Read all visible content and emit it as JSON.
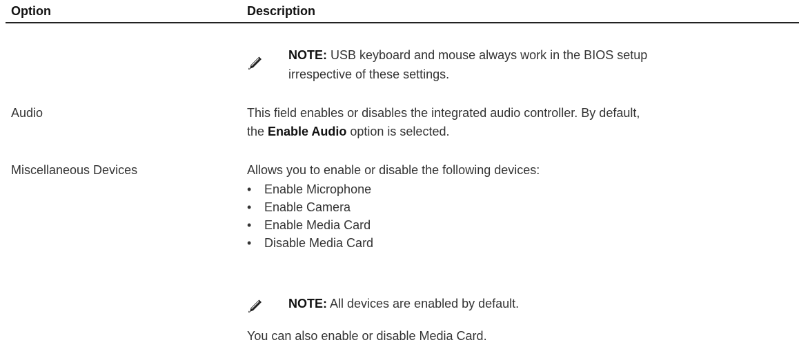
{
  "table": {
    "header": {
      "option": "Option",
      "description": "Description"
    },
    "note1": {
      "icon": "pencil-note-icon",
      "label": "NOTE:",
      "text_line1": " USB keyboard and mouse always work in the BIOS setup",
      "text_line2": "irrespective of these settings."
    },
    "audio": {
      "option": "Audio",
      "desc_line1": "This field enables or disables the integrated audio controller. By default,",
      "desc_pre": "the ",
      "desc_bold": "Enable Audio",
      "desc_post": " option is selected."
    },
    "misc": {
      "option": "Miscellaneous Devices",
      "intro": "Allows you to enable or disable the following devices:",
      "items": [
        "Enable Microphone",
        "Enable Camera",
        "Enable Media Card",
        "Disable Media Card"
      ],
      "note": {
        "icon": "pencil-note-icon",
        "label": "NOTE:",
        "text": " All devices are enabled by default."
      },
      "footer": "You can also enable or disable Media Card."
    }
  }
}
